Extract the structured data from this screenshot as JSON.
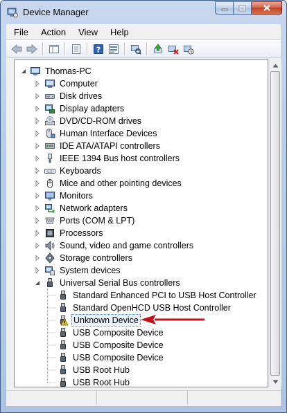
{
  "window": {
    "title": "Device Manager"
  },
  "menu": [
    {
      "id": "file",
      "label": "File"
    },
    {
      "id": "action",
      "label": "Action"
    },
    {
      "id": "view",
      "label": "View"
    },
    {
      "id": "help",
      "label": "Help"
    }
  ],
  "toolbar": [
    "back-arrow-icon",
    "forward-arrow-icon",
    "show-hide-console-tree-icon",
    "properties-icon",
    "help-icon",
    "details-view-icon",
    "scan-hardware-changes-icon",
    "update-driver-icon",
    "uninstall-device-icon",
    "disable-device-icon"
  ],
  "tree": {
    "root": "Thomas-PC",
    "categories": [
      {
        "label": "Computer",
        "icon": "computer-icon"
      },
      {
        "label": "Disk drives",
        "icon": "disk-drive-icon"
      },
      {
        "label": "Display adapters",
        "icon": "display-adapter-icon"
      },
      {
        "label": "DVD/CD-ROM drives",
        "icon": "dvd-drive-icon"
      },
      {
        "label": "Human Interface Devices",
        "icon": "hid-icon"
      },
      {
        "label": "IDE ATA/ATAPI controllers",
        "icon": "ide-controller-icon"
      },
      {
        "label": "IEEE 1394 Bus host controllers",
        "icon": "firewire-icon"
      },
      {
        "label": "Keyboards",
        "icon": "keyboard-icon"
      },
      {
        "label": "Mice and other pointing devices",
        "icon": "mouse-icon"
      },
      {
        "label": "Monitors",
        "icon": "monitor-icon"
      },
      {
        "label": "Network adapters",
        "icon": "network-adapter-icon"
      },
      {
        "label": "Ports (COM & LPT)",
        "icon": "port-icon"
      },
      {
        "label": "Processors",
        "icon": "processor-icon"
      },
      {
        "label": "Sound, video and game controllers",
        "icon": "sound-icon"
      },
      {
        "label": "Storage controllers",
        "icon": "storage-controller-icon"
      },
      {
        "label": "System devices",
        "icon": "system-device-icon"
      },
      {
        "label": "Universal Serial Bus controllers",
        "icon": "usb-icon"
      }
    ],
    "usb_children": [
      {
        "label": "Standard Enhanced PCI to USB Host Controller",
        "warning": false
      },
      {
        "label": "Standard OpenHCD USB Host Controller",
        "warning": false
      },
      {
        "label": "Unknown Device",
        "warning": true
      },
      {
        "label": "USB Composite Device",
        "warning": false
      },
      {
        "label": "USB Composite Device",
        "warning": false
      },
      {
        "label": "USB Composite Device",
        "warning": false
      },
      {
        "label": "USB Root Hub",
        "warning": false
      },
      {
        "label": "USB Root Hub",
        "warning": false
      }
    ]
  },
  "colors": {
    "annotation_arrow": "#c0121a",
    "selection_border": "#5a7dbf",
    "warning": "#f4c515"
  }
}
